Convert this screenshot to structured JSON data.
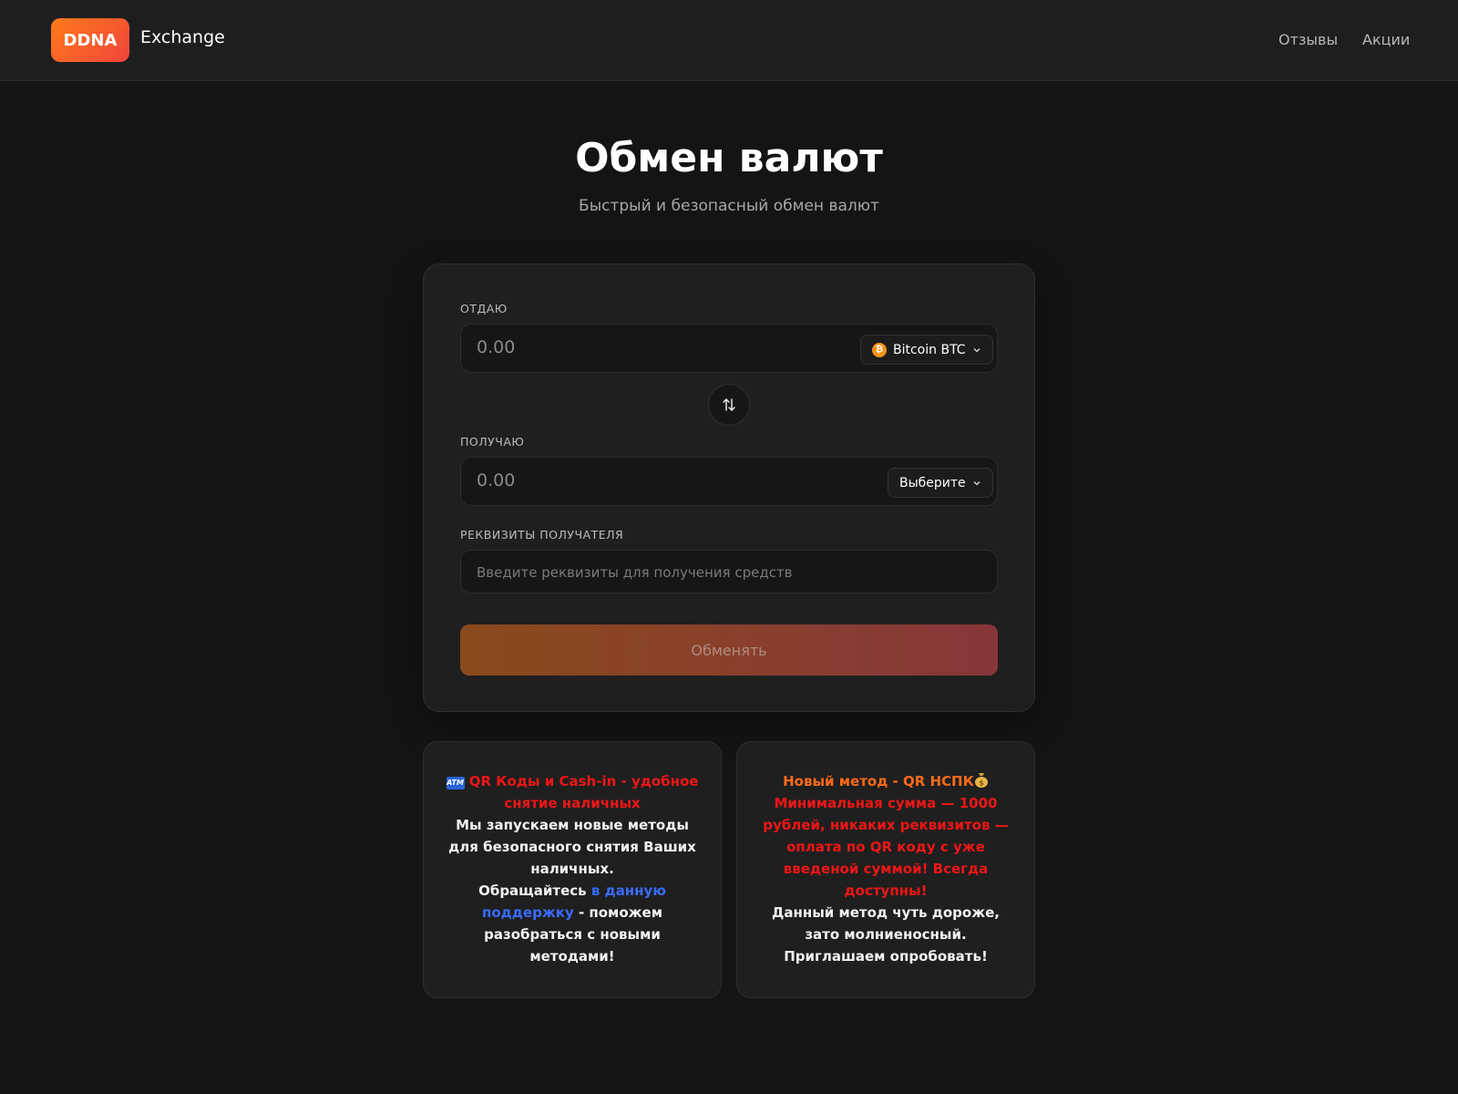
{
  "header": {
    "logo_badge": "DDNA",
    "logo_text": "Exchange",
    "nav": [
      "Отзывы",
      "Акции"
    ]
  },
  "page": {
    "title": "Обмен валют",
    "subtitle": "Быстрый и безопасный обмен валют"
  },
  "form": {
    "give_label": "ОТДАЮ",
    "give_value": "0.00",
    "give_currency": "Bitcoin BTC",
    "receive_label": "ПОЛУЧАЮ",
    "receive_value": "0.00",
    "receive_currency": "Выберите",
    "details_label": "РЕКВИЗИТЫ ПОЛУЧАТЕЛЯ",
    "details_placeholder": "Введите реквизиты для получения средств",
    "submit_label": "Обменять"
  },
  "info_left": {
    "emoji_label": "ATM",
    "title": "QR Коды и Cash-in - удобное снятие наличных",
    "body": "Мы запускаем новые методы для безопасного снятия Ваших наличных.",
    "cta_prefix": "Обращайтесь ",
    "cta_link": "в данную поддержку",
    "cta_suffix": " - поможем разобраться с новыми методами!"
  },
  "info_right": {
    "title": "Новый метод - QR НСПК",
    "highlight": "Минимальная сумма — 1000 рублей, никаких реквизитов — оплата по QR коду с уже введеной суммой! Всегда доступны!",
    "body": "Данный метод чуть дороже, зато молниеносный. Приглашаем опробовать!"
  },
  "colors": {
    "accent_orange": "#ff7a1a",
    "accent_red": "#f0453a",
    "alert_red": "#f01616",
    "link_blue": "#3a6bff"
  }
}
